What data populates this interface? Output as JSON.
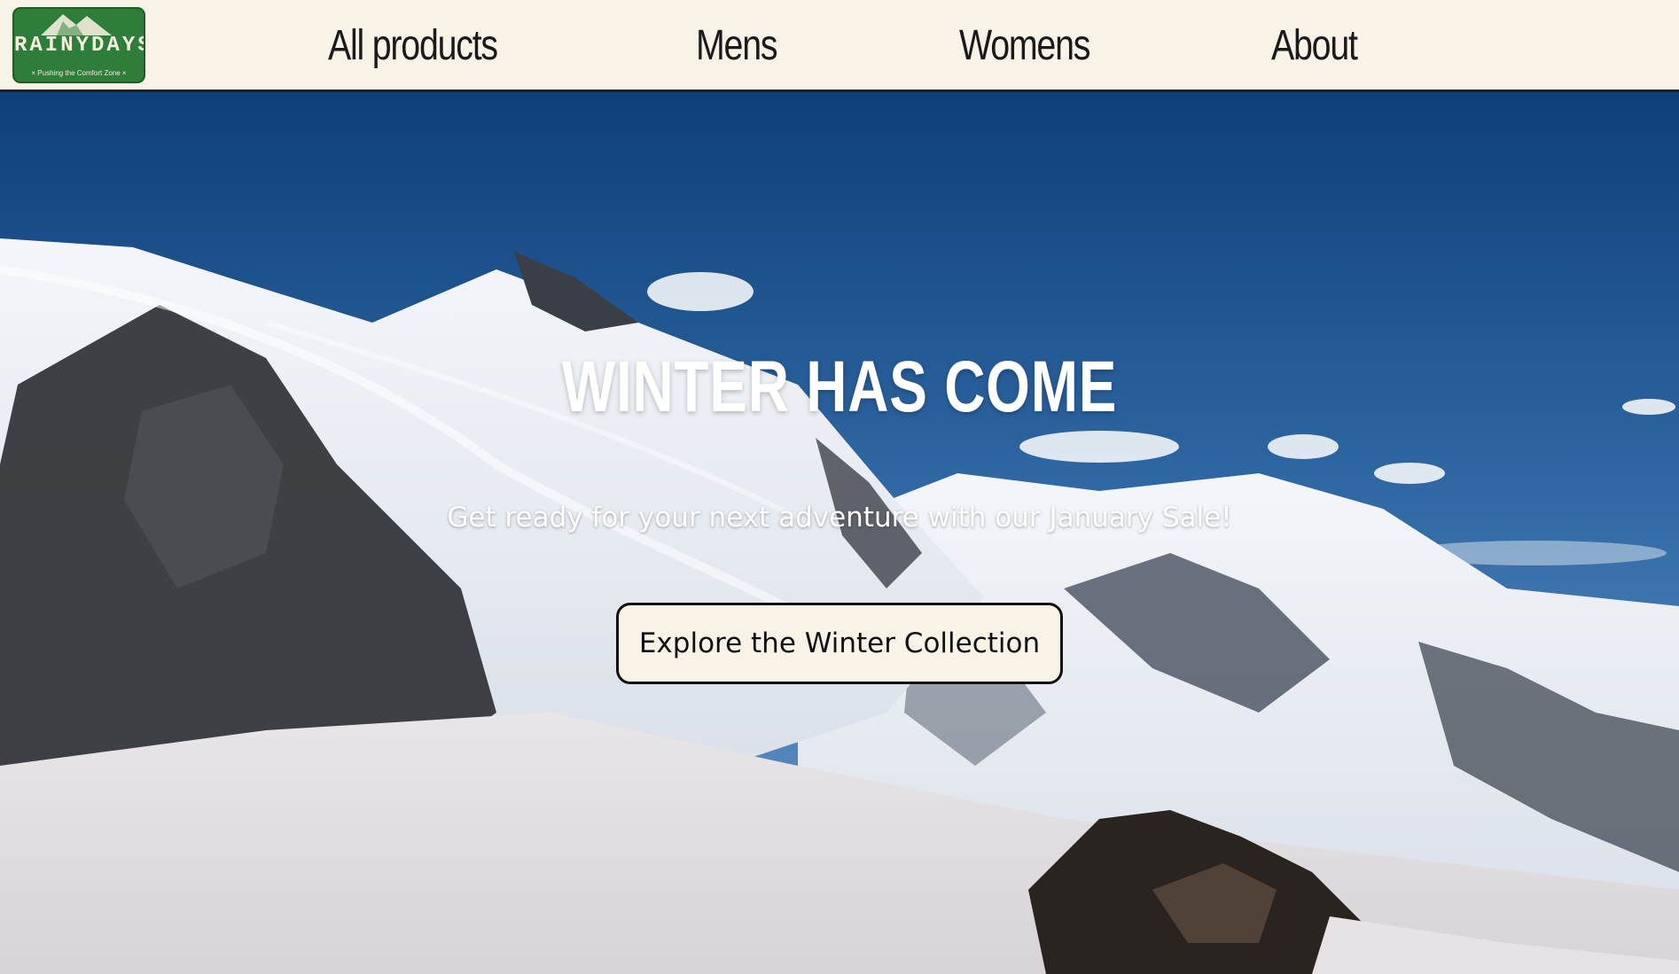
{
  "brand": {
    "logo_text": "RAINYDAYS",
    "logo_tagline": "× Pushing the Comfort Zone ×",
    "logo_color": "#2e7d3a"
  },
  "nav": {
    "items": [
      {
        "label": "All products"
      },
      {
        "label": "Mens"
      },
      {
        "label": "Womens"
      },
      {
        "label": "About"
      }
    ]
  },
  "hero": {
    "title": "WINTER HAS COME",
    "subtitle": "Get ready for your next adventure with our January Sale!",
    "cta_label": "Explore the Winter Collection",
    "background": "snowy-mountain-image"
  },
  "colors": {
    "header_bg": "#f9f2e6",
    "sky": "#2b5f93",
    "text_dark": "#1a1a1a"
  }
}
